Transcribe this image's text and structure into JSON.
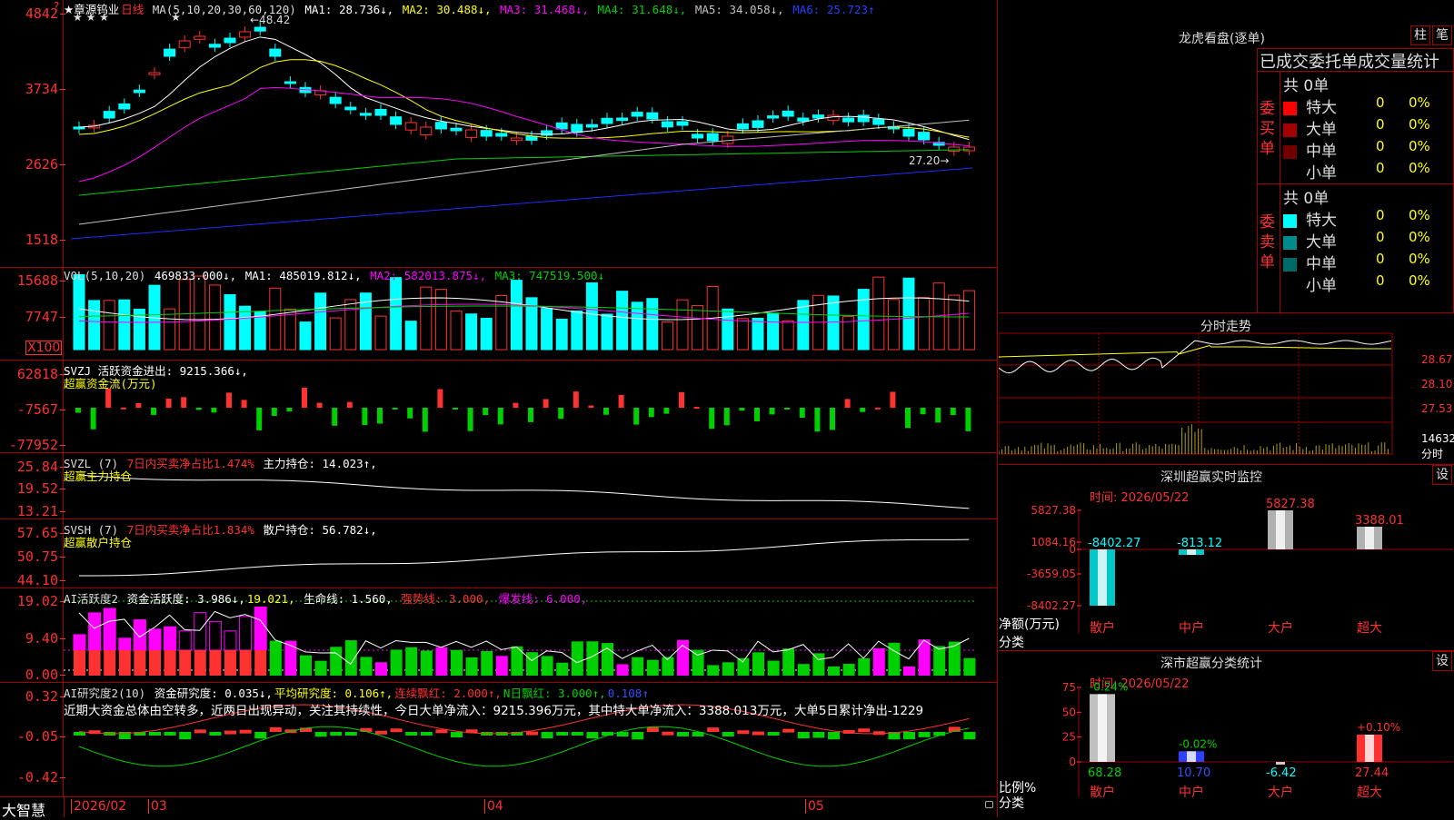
{
  "colors": {
    "up": "#ff3232",
    "down": "#00ffff",
    "bg": "#000000",
    "frame": "#a00000",
    "white": "#ffffff",
    "yellow": "#ffff00",
    "magenta": "#ff00ff",
    "green": "#00d000",
    "blue": "#1d2dff",
    "gray": "#c0c0c0"
  },
  "header": {
    "title": "★章源钨业",
    "period": "日线",
    "ma_label": "MA(5,10,20,30,60,120)",
    "ma1": "MA1: 28.736↓,",
    "ma2": "MA2: 30.488↓,",
    "ma3": "MA3: 31.468↓,",
    "ma4": "MA4: 31.648↓,",
    "ma5": "MA5: 34.058↓,",
    "ma6": "MA6: 25.723↑",
    "star_marks": "★ ★ ★",
    "star_mark2": "★",
    "high_mark": "←48.42",
    "low_mark": "27.20→"
  },
  "price_axis": [
    "4842",
    "3734",
    "2626",
    "1518"
  ],
  "vol": {
    "label": "VOL(5,10,20)",
    "v": "469833.000↓,",
    "ma1": "MA1: 485019.812↓,",
    "ma2": "MA2: 582013.875↓,",
    "ma3": "MA3: 747519.500↓",
    "axis": [
      "15688",
      "7747"
    ],
    "unit": "X100"
  },
  "svzj": {
    "label": "SVZJ  活跃资金进出: 9215.366↓,",
    "sub": "超赢资金流(万元)",
    "axis": [
      "62818",
      "-7567",
      "-77952"
    ]
  },
  "svzl": {
    "label": "SVZL (7)",
    "label2": "7日内买卖净占比1.474%",
    "label3": "主力持仓: 14.023↑,",
    "sub": "超赢主力持仓",
    "axis": [
      "25.84",
      "19.52",
      "13.21"
    ]
  },
  "svsh": {
    "label": "SVSH (7)",
    "label2": "7日内买卖净占比1.834%",
    "label3": "散户持仓: 56.782↓,",
    "sub": "超赢散户持仓",
    "axis": [
      "57.65",
      "50.75",
      "44.10"
    ]
  },
  "ai1": {
    "label": "AI活跃度2",
    "v1": "资金活跃度: 3.986↓,",
    "v2": "19.021,",
    "v3": "生命线: 1.560,",
    "v4": "强势线: 3.000,",
    "v5": "爆发线: 6.000,",
    "axis": [
      "19.02",
      "9.40",
      "0.00"
    ]
  },
  "ai2": {
    "label": "AI研究度2(10)",
    "v1": "资金研究度: 0.035↓,",
    "v2": "平均研究度: 0.106↑,",
    "v3": "连续飘红: 2.000↑,",
    "v4": "N日飘红: 3.000↑,",
    "v5": "0.108↑",
    "comment": "近期大资金总体由空转多，近两日出现异动，关注其持续性，今日大单净流入：9215.396万元，其中特大单净流入：3388.013万元，大单5日累计净出-1229",
    "axis": [
      "0.32",
      "-0.05",
      "-0.42"
    ]
  },
  "timeline": {
    "brand": "大智慧",
    "labels": [
      "2026/02",
      "03",
      "04",
      "05"
    ]
  },
  "dragon": {
    "title": "龙虎看盘(逐单)",
    "btn1": "柱",
    "btn2": "笔",
    "subtitle": "已成交委托单成交量统计",
    "buy_label": "委买单",
    "sell_label": "委卖单",
    "buy_total": "共 0单",
    "sell_total": "共 0单",
    "buy_rows": [
      {
        "name": "特大",
        "n": "0",
        "p": "0%",
        "color": "#ff0000"
      },
      {
        "name": "大单",
        "n": "0",
        "p": "0%",
        "color": "#a00000"
      },
      {
        "name": "中单",
        "n": "0",
        "p": "0%",
        "color": "#700000"
      },
      {
        "name": "小单",
        "n": "0",
        "p": "0%",
        "color": "#000000"
      }
    ],
    "sell_rows": [
      {
        "name": "特大",
        "n": "0",
        "p": "0%",
        "color": "#00ffff"
      },
      {
        "name": "大单",
        "n": "0",
        "p": "0%",
        "color": "#008c8c"
      },
      {
        "name": "中单",
        "n": "0",
        "p": "0%",
        "color": "#006a6a"
      },
      {
        "name": "小单",
        "n": "0",
        "p": "0%",
        "color": "#000000"
      }
    ]
  },
  "intraday": {
    "title": "分时走势",
    "axis": [
      "28.67",
      "28.10",
      "27.53"
    ],
    "vol_label": "14632",
    "vol_unit": "分时"
  },
  "monitor": {
    "title": "深圳超赢实时监控",
    "btn": "设",
    "time": "时间: 2026/05/22",
    "axis": [
      "5827.38",
      "1084.16",
      "0",
      "-3659.05",
      "-8402.27"
    ],
    "ylabel": "净额(万元)",
    "xlabel": "分类",
    "chart_data": {
      "type": "bar",
      "categories": [
        "散户",
        "中户",
        "大户",
        "超大"
      ],
      "values": [
        -8402.27,
        -813.12,
        5827.38,
        3388.01
      ],
      "ylim": [
        -8402.27,
        5827.38
      ]
    },
    "value_labels": [
      "-8402.27",
      "-813.12",
      "5827.38",
      "3388.01"
    ]
  },
  "stats": {
    "title": "深市超赢分类统计",
    "btn": "设",
    "time": "时间: 2026/05/22",
    "axis": [
      "75",
      "50",
      "25",
      "0"
    ],
    "ylabel": "比例%",
    "xlabel": "分类",
    "chart_data": {
      "type": "bar",
      "categories": [
        "散户",
        "中户",
        "大户",
        "超大"
      ],
      "values": [
        68.28,
        10.7,
        -6.42,
        27.44
      ],
      "changes": [
        "-0.24%",
        "-0.02%",
        "",
        "+0.10%"
      ],
      "ylim": [
        0,
        75
      ]
    },
    "value_labels": [
      "68.28",
      "10.70",
      "-6.42",
      "27.44"
    ]
  }
}
